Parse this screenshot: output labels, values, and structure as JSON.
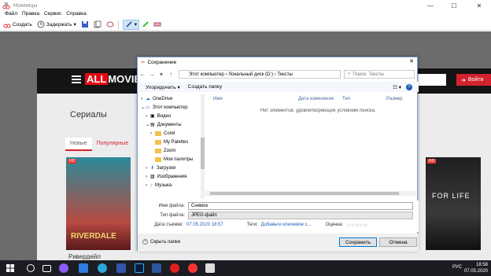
{
  "window": {
    "title": "Ножницы"
  },
  "menu": [
    "Файл",
    "Правка",
    "Сервис",
    "Справка"
  ],
  "toolbar": {
    "create_label": "Создать",
    "delay_label": "Задержать"
  },
  "site": {
    "logo_all": "ALL",
    "logo_movies": "MOVIES",
    "login_label": "Войти",
    "section_title": "Сериалы",
    "filters": [
      "Новые",
      "Популярные"
    ],
    "poster1_name": "RIVERDALE",
    "poster1_badge": "HD",
    "poster2_name": "FOR LIFE",
    "poster2_badge": "HD",
    "caption": "Ривердейл"
  },
  "dialog": {
    "title": "Сохранение",
    "address": [
      "Этот компьютер",
      "Локальный диск (D:)",
      "Тексты"
    ],
    "search_placeholder": "Поиск: Тексты",
    "organize": "Упорядочить ▾",
    "new_folder": "Создать папку",
    "tree": [
      "OneDrive",
      "Этот компьютер",
      "Видео",
      "Документы",
      "Corel",
      "My Palettes",
      "Zoom",
      "Мои палитры",
      "Загрузки",
      "Изображения",
      "Музыка"
    ],
    "columns": [
      "Имя",
      "Дата изменения",
      "Тип",
      "Размер"
    ],
    "empty_text": "Нет элементов, удовлетворяющих условиям поиска.",
    "filename_label": "Имя файла:",
    "filename_value": "Снимок",
    "filetype_label": "Тип файла:",
    "filetype_value": "JPEG-файл",
    "date_label": "Дата съемки:",
    "date_value": "07.05.2020 18:57",
    "tags_label": "Теги:",
    "tags_value": "Добавьте ключевое с...",
    "rating_label": "Оценка:",
    "rating_value": "☆☆☆☆☆",
    "hide_folders": "Скрыть папки",
    "save_label": "Сохранить",
    "cancel_label": "Отмена"
  },
  "taskbar": {
    "lang": "РУС",
    "time": "18:58",
    "date": "07.05.2020"
  },
  "colors": {
    "accent": "#d3232f",
    "link": "#1e60b5",
    "taskbar": "#1c1d22"
  }
}
